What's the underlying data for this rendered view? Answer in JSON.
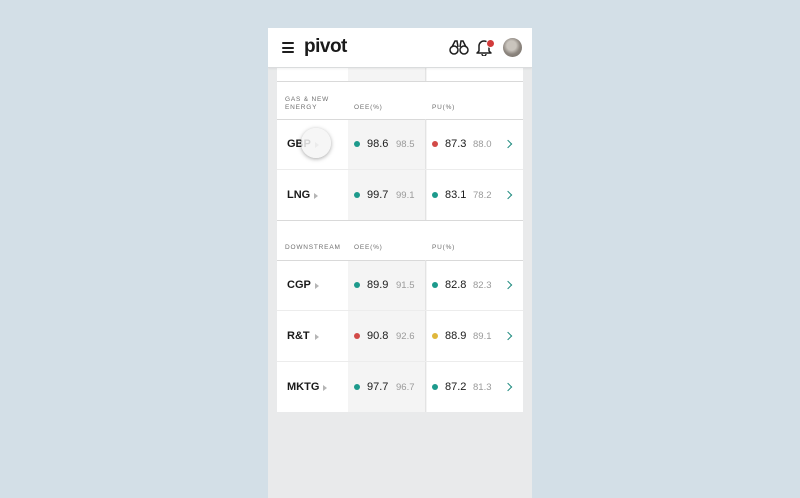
{
  "app": {
    "logo_text": "pivot"
  },
  "header_icons": [
    "menu-icon",
    "binoculars-icon",
    "bell-icon",
    "avatar"
  ],
  "colors": {
    "good": "#1d9a8c",
    "bad": "#d24a47",
    "warn": "#e0b73b",
    "chevron": "#1d8a7d"
  },
  "sections": [
    {
      "label": "GAS & NEW ENERGY",
      "col1": "OEE(%)",
      "col2": "PU(%)",
      "rows": [
        {
          "name": "GBP",
          "oee": "98.6",
          "oee_prev": "98.5",
          "oee_status": "good",
          "pu": "87.3",
          "pu_prev": "88.0",
          "pu_status": "bad"
        },
        {
          "name": "LNG",
          "oee": "99.7",
          "oee_prev": "99.1",
          "oee_status": "good",
          "pu": "83.1",
          "pu_prev": "78.2",
          "pu_status": "good"
        }
      ]
    },
    {
      "label": "DOWNSTREAM",
      "col1": "OEE(%)",
      "col2": "PU(%)",
      "rows": [
        {
          "name": "CGP",
          "oee": "89.9",
          "oee_prev": "91.5",
          "oee_status": "good",
          "pu": "82.8",
          "pu_prev": "82.3",
          "pu_status": "good"
        },
        {
          "name": "R&T",
          "oee": "90.8",
          "oee_prev": "92.6",
          "oee_status": "bad",
          "pu": "88.9",
          "pu_prev": "89.1",
          "pu_status": "warn"
        },
        {
          "name": "MKTG",
          "oee": "97.7",
          "oee_prev": "96.7",
          "oee_status": "good",
          "pu": "87.2",
          "pu_prev": "81.3",
          "pu_status": "good"
        }
      ]
    }
  ]
}
